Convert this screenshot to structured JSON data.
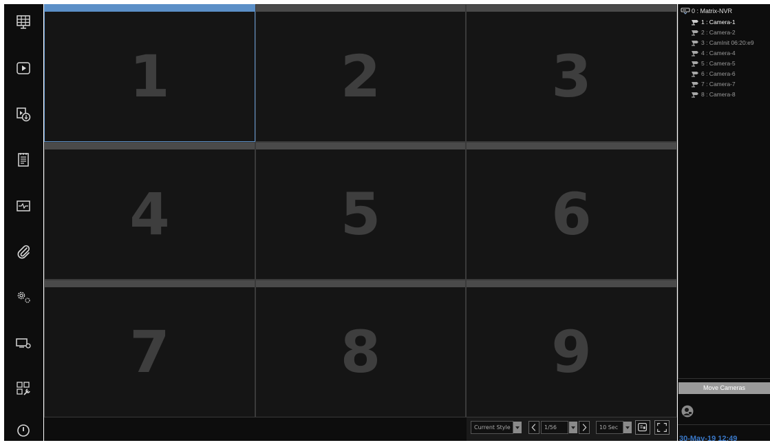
{
  "sidebar": {
    "items": [
      {
        "icon": "live-view-grid-icon"
      },
      {
        "icon": "playback-icon"
      },
      {
        "icon": "video-download-icon"
      },
      {
        "icon": "event-log-icon"
      },
      {
        "icon": "system-health-icon"
      },
      {
        "icon": "attachment-icon"
      },
      {
        "icon": "settings-gears-icon"
      },
      {
        "icon": "display-settings-icon"
      },
      {
        "icon": "layout-tools-icon"
      },
      {
        "icon": "power-icon"
      }
    ]
  },
  "grid": {
    "tiles": [
      "1",
      "2",
      "3",
      "4",
      "5",
      "6",
      "7",
      "8",
      "9"
    ],
    "selected_tile": "1"
  },
  "toolbar": {
    "style_select": "Current Style",
    "page_indicator": "1/56",
    "interval_select": "10 Sec"
  },
  "device_tree": {
    "root": "0 : Matrix-NVR",
    "cameras": [
      "1 : Camera-1",
      "2 : Camera-2",
      "3 : CamInit 06:20:e9",
      "4 : Camera-4",
      "5 : Camera-5",
      "6 : Camera-6",
      "7 : Camera-7",
      "8 : Camera-8"
    ],
    "active_camera": "1 : Camera-1"
  },
  "right_panel": {
    "move_cameras_label": "Move Cameras",
    "datetime": "30-May-19 12:49"
  },
  "colors": {
    "accent": "#5b8fc7",
    "background": "#0d0d0d",
    "tile_number": "#3e3e3e",
    "datetime": "#3a78c8"
  }
}
